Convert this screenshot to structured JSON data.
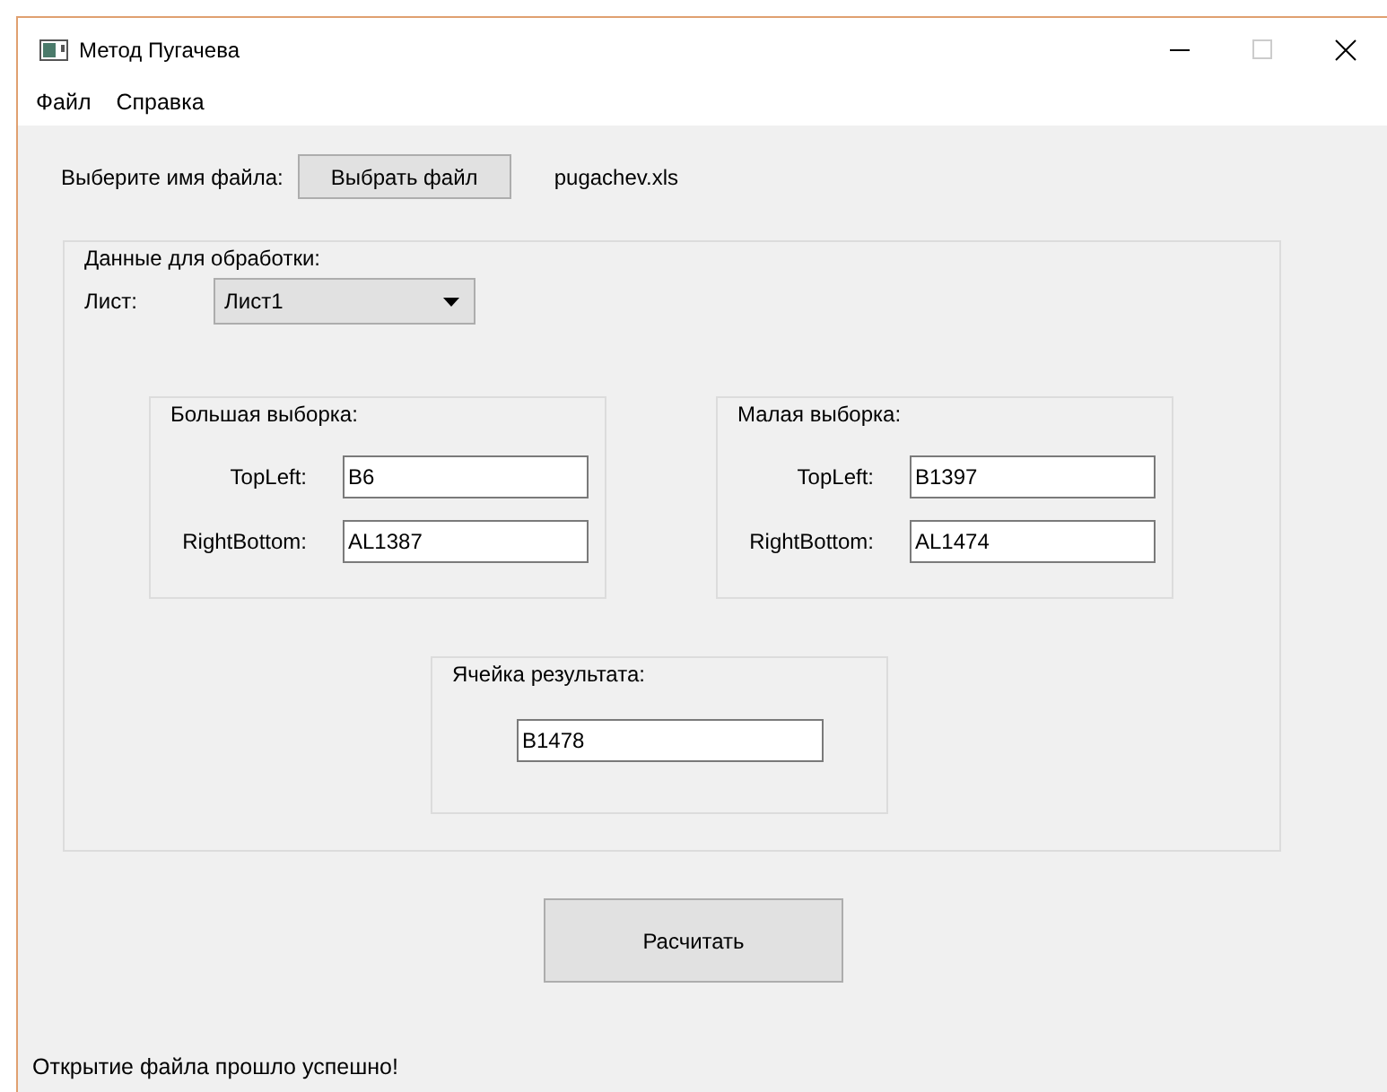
{
  "window": {
    "title": "Метод Пугачева"
  },
  "menu": [
    "Файл",
    "Справка"
  ],
  "file": {
    "label": "Выберите имя файла:",
    "button": "Выбрать файл",
    "filename": "pugachev.xls"
  },
  "data_group": {
    "title": "Данные для обработки:",
    "sheet_label": "Лист:",
    "sheet_value": "Лист1",
    "groups": [
      {
        "title": "Большая выборка:",
        "fields": [
          {
            "label": "TopLeft:",
            "value": "B6"
          },
          {
            "label": "RightBottom:",
            "value": "AL1387"
          }
        ]
      },
      {
        "title": "Малая выборка:",
        "fields": [
          {
            "label": "TopLeft:",
            "value": "B1397"
          },
          {
            "label": "RightBottom:",
            "value": "AL1474"
          }
        ]
      }
    ],
    "result": {
      "title": "Ячейка результата:",
      "value": "B1478"
    }
  },
  "calculate_button": "Расчитать",
  "status_bar": "Открытие файла прошло успешно!"
}
